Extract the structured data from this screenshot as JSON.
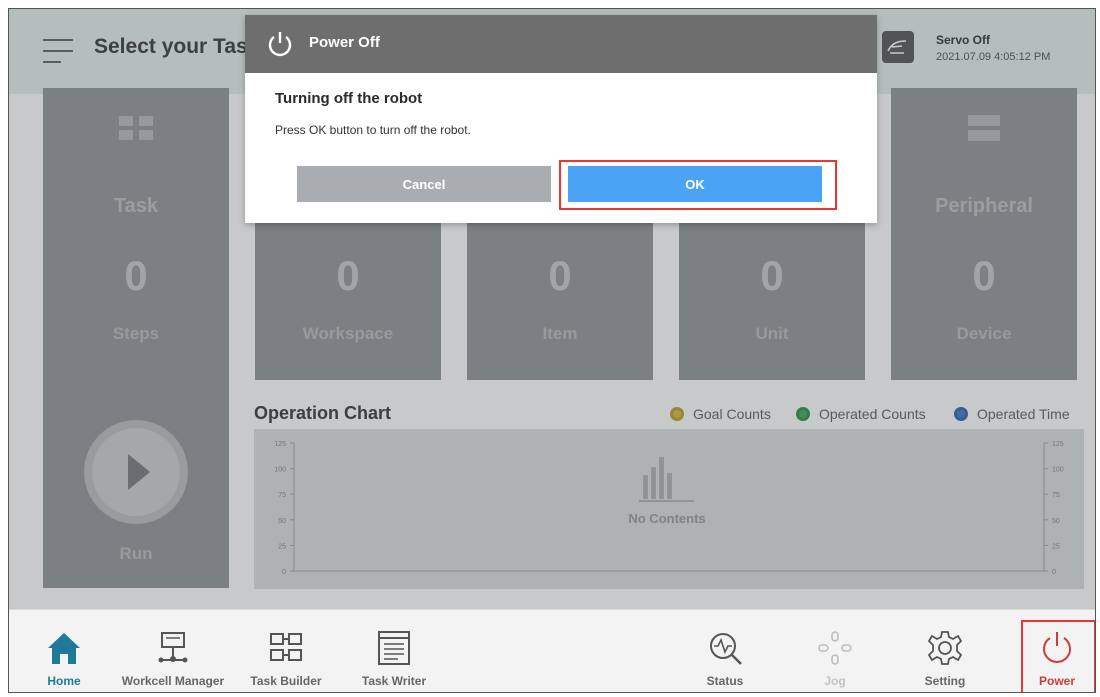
{
  "header": {
    "title": "Select your Task",
    "servo_status": "Servo Off",
    "datetime": "2021.07.09 4:05:12 PM"
  },
  "run_panel": {
    "title": "Task",
    "value": "0",
    "unit": "Steps",
    "run_label": "Run"
  },
  "cards": [
    {
      "value": "0",
      "unit": "Workspace"
    },
    {
      "value": "0",
      "unit": "Item"
    },
    {
      "value": "0",
      "unit": "Unit"
    },
    {
      "title": "Peripheral",
      "value": "0",
      "unit": "Device"
    }
  ],
  "chart": {
    "title": "Operation Chart",
    "legend": [
      {
        "label": "Goal Counts",
        "color": "#d9b42a"
      },
      {
        "label": "Operated Counts",
        "color": "#2ea84a"
      },
      {
        "label": "Operated Time",
        "color": "#2f6fd0"
      }
    ],
    "y_ticks": [
      "125",
      "100",
      "75",
      "50",
      "25",
      "0"
    ],
    "empty_text": "No Contents"
  },
  "dialog": {
    "header_title": "Power Off",
    "heading": "Turning off the robot",
    "message": "Press OK button to turn off the robot.",
    "cancel_label": "Cancel",
    "ok_label": "OK"
  },
  "nav": [
    {
      "label": "Home",
      "icon": "home-icon"
    },
    {
      "label": "Workcell Manager",
      "icon": "workcell-icon"
    },
    {
      "label": "Task Builder",
      "icon": "task-builder-icon"
    },
    {
      "label": "Task Writer",
      "icon": "task-writer-icon"
    },
    {
      "label": "Status",
      "icon": "status-icon"
    },
    {
      "label": "Jog",
      "icon": "jog-icon"
    },
    {
      "label": "Setting",
      "icon": "gear-icon"
    },
    {
      "label": "Power",
      "icon": "power-icon"
    }
  ]
}
